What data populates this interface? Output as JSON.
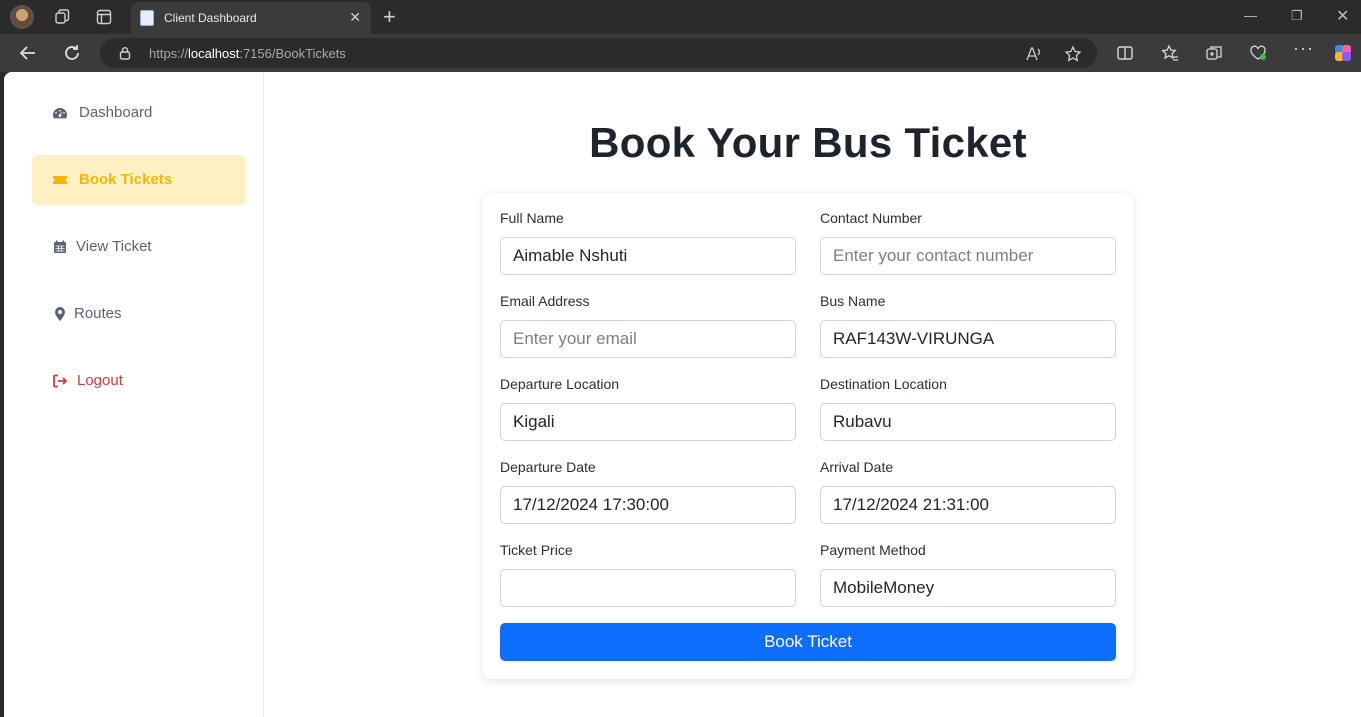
{
  "browser": {
    "tab_title": "Client Dashboard",
    "url_prefix": "https://",
    "url_host": "localhost",
    "url_rest": ":7156/BookTickets",
    "accent": "#0d6efd"
  },
  "sidebar": {
    "items": [
      {
        "label": "Dashboard",
        "icon": "gauge-icon"
      },
      {
        "label": "Book Tickets",
        "icon": "ticket-icon",
        "active": true
      },
      {
        "label": "View Ticket",
        "icon": "calendar-icon"
      },
      {
        "label": "Routes",
        "icon": "map-pin-icon"
      },
      {
        "label": "Logout",
        "icon": "logout-icon"
      }
    ]
  },
  "form": {
    "title": "Book Your Bus Ticket",
    "full_name": {
      "label": "Full Name",
      "value": "Aimable Nshuti",
      "placeholder": ""
    },
    "contact": {
      "label": "Contact Number",
      "value": "",
      "placeholder": "Enter your contact number"
    },
    "email": {
      "label": "Email Address",
      "value": "",
      "placeholder": "Enter your email"
    },
    "bus_name": {
      "label": "Bus Name",
      "value": "RAF143W-VIRUNGA",
      "placeholder": ""
    },
    "departure_location": {
      "label": "Departure Location",
      "value": "Kigali",
      "placeholder": ""
    },
    "destination_location": {
      "label": "Destination Location",
      "value": "Rubavu",
      "placeholder": ""
    },
    "departure_date": {
      "label": "Departure Date",
      "value": "17/12/2024 17:30:00",
      "placeholder": ""
    },
    "arrival_date": {
      "label": "Arrival Date",
      "value": "17/12/2024 21:31:00",
      "placeholder": ""
    },
    "ticket_price": {
      "label": "Ticket Price",
      "value": "",
      "placeholder": ""
    },
    "payment_method": {
      "label": "Payment Method",
      "value": "MobileMoney",
      "placeholder": ""
    },
    "submit_label": "Book Ticket"
  }
}
